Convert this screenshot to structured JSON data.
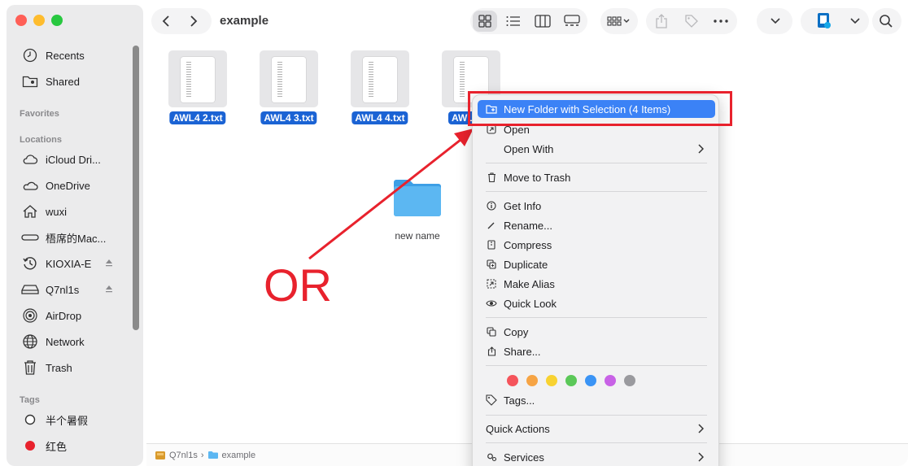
{
  "window": {
    "title": "example"
  },
  "sidebar": {
    "items_top": [
      {
        "label": "Recents",
        "icon": "clock-icon"
      },
      {
        "label": "Shared",
        "icon": "shared-folder-icon"
      }
    ],
    "sections": {
      "favorites": "Favorites",
      "locations": "Locations",
      "tags": "Tags"
    },
    "locations": [
      {
        "label": "iCloud Dri...",
        "icon": "cloud-icon"
      },
      {
        "label": "OneDrive",
        "icon": "cloud-outline-icon"
      },
      {
        "label": "wuxi",
        "icon": "home-icon"
      },
      {
        "label": "梧席的Mac...",
        "icon": "laptop-drive-icon"
      },
      {
        "label": "KIOXIA-E",
        "icon": "time-machine-icon"
      },
      {
        "label": "Q7nl1s",
        "icon": "external-drive-icon"
      },
      {
        "label": "AirDrop",
        "icon": "airdrop-icon"
      },
      {
        "label": "Network",
        "icon": "globe-icon"
      },
      {
        "label": "Trash",
        "icon": "trash-icon"
      }
    ],
    "tags": [
      {
        "label": "半个暑假",
        "color": "#ffffff"
      },
      {
        "label": "红色",
        "color": "#e8222d"
      }
    ]
  },
  "files": [
    {
      "label": "AWL4 2.txt"
    },
    {
      "label": "AWL4 3.txt"
    },
    {
      "label": "AWL4 4.txt"
    },
    {
      "label": "AWL"
    }
  ],
  "folder": {
    "label": "new name"
  },
  "annotation": {
    "text": "OR",
    "color": "#e8222d"
  },
  "context_menu": {
    "new_folder": "New Folder with Selection (4 Items)",
    "open": "Open",
    "open_with": "Open With",
    "move_to_trash": "Move to Trash",
    "get_info": "Get Info",
    "rename": "Rename...",
    "compress": "Compress",
    "duplicate": "Duplicate",
    "make_alias": "Make Alias",
    "quick_look": "Quick Look",
    "copy": "Copy",
    "share": "Share...",
    "tags": "Tags...",
    "quick_actions": "Quick Actions",
    "services": "Services",
    "tag_colors": [
      "#f5545b",
      "#f6a444",
      "#f8d231",
      "#5bc858",
      "#3b94f5",
      "#c862e6",
      "#9a9a9e"
    ]
  },
  "pathbar": {
    "items": [
      "Q7nl1s",
      "example"
    ]
  }
}
